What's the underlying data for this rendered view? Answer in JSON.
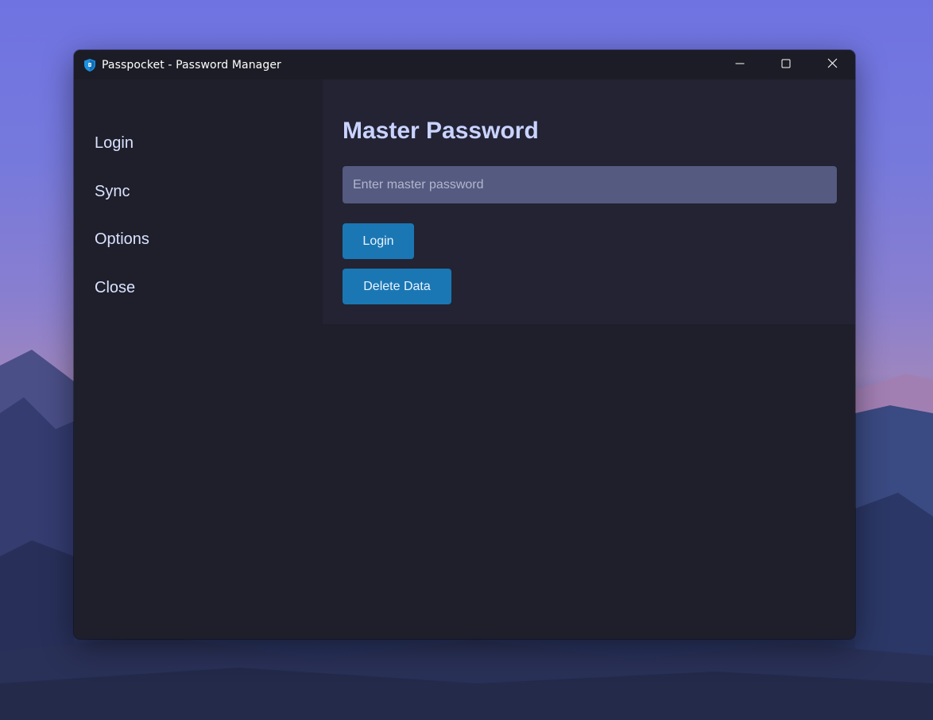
{
  "window": {
    "title": "Passpocket - Password Manager",
    "app_icon": "shield-icon",
    "controls": {
      "minimize_icon": "minimize-icon",
      "maximize_icon": "maximize-icon",
      "close_icon": "close-icon"
    }
  },
  "sidebar": {
    "items": [
      {
        "label": "Login"
      },
      {
        "label": "Sync"
      },
      {
        "label": "Options"
      },
      {
        "label": "Close"
      }
    ]
  },
  "main": {
    "heading": "Master Password",
    "password_field": {
      "value": "",
      "placeholder": "Enter master password"
    },
    "login_button": "Login",
    "delete_button": "Delete Data"
  },
  "colors": {
    "accent": "#1a77b4",
    "heading": "#c9d3ff",
    "sidebar_text": "#d9e2ff",
    "window_bg": "#1f1f2b",
    "card_bg": "#232334",
    "input_bg": "#555a80"
  }
}
